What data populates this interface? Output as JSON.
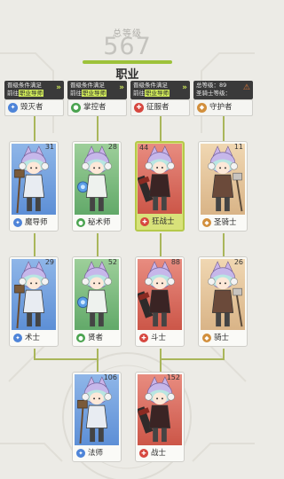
{
  "header": {
    "total_label": "总等级",
    "total_value": "567",
    "title": "职业"
  },
  "requirements": [
    {
      "line1": "晋级条件满足",
      "line2_prefix": "前往",
      "line2_link": "职业导师",
      "state": "ready"
    },
    {
      "line1": "晋级条件满足",
      "line2_prefix": "前往",
      "line2_link": "职业导师",
      "state": "ready"
    },
    {
      "line1": "晋级条件满足",
      "line2_prefix": "前往",
      "line2_link": "职业导师",
      "state": "ready"
    },
    {
      "line1": "总等级：89",
      "line2_prefix": "圣骑士等级：",
      "line2_link": "",
      "state": "locked"
    }
  ],
  "tier1": [
    {
      "name": "毁灭者",
      "icon": "staff-icon",
      "color": "#4e84d8"
    },
    {
      "name": "掌控者",
      "icon": "orb-icon",
      "color": "#4aa34f"
    },
    {
      "name": "征服者",
      "icon": "axe-icon",
      "color": "#d6473f"
    },
    {
      "name": "守护者",
      "icon": "shield-icon",
      "color": "#d28f3c"
    }
  ],
  "tier2": [
    {
      "name": "魔导师",
      "level": "31",
      "theme": "blue",
      "icon": "staff-icon"
    },
    {
      "name": "秘术师",
      "level": "28",
      "theme": "green",
      "icon": "orb-icon"
    },
    {
      "name": "狂战士",
      "level": "44",
      "theme": "red",
      "icon": "axe-icon",
      "selected": true
    },
    {
      "name": "圣骑士",
      "level": "11",
      "theme": "tan",
      "icon": "shield-icon"
    }
  ],
  "tier3": [
    {
      "name": "术士",
      "level": "29",
      "theme": "blue",
      "icon": "staff-icon"
    },
    {
      "name": "贤者",
      "level": "52",
      "theme": "green",
      "icon": "orb-icon"
    },
    {
      "name": "斗士",
      "level": "88",
      "theme": "red",
      "icon": "axe-icon"
    },
    {
      "name": "骑士",
      "level": "26",
      "theme": "tan",
      "icon": "shield-icon"
    }
  ],
  "tier4": [
    {
      "name": "法师",
      "level": "106",
      "theme": "blue",
      "icon": "staff-icon"
    },
    {
      "name": "战士",
      "level": "152",
      "theme": "red",
      "icon": "axe-icon"
    }
  ]
}
